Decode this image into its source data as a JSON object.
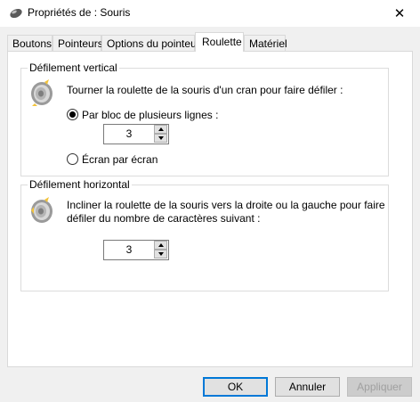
{
  "window": {
    "title": "Propriétés de : Souris",
    "close_glyph": "✕"
  },
  "tabs": [
    {
      "label": "Boutons"
    },
    {
      "label": "Pointeurs"
    },
    {
      "label": "Options du pointeur"
    },
    {
      "label": "Roulette",
      "active": true
    },
    {
      "label": "Matériel"
    }
  ],
  "vertical": {
    "title": "Défilement vertical",
    "description": "Tourner la roulette de la souris d'un cran pour faire défiler :",
    "option_lines": "Par bloc de plusieurs lignes :",
    "option_lines_checked": true,
    "lines_value": "3",
    "option_screen": "Écran par écran",
    "icon": "mouse-wheel-icon"
  },
  "horizontal": {
    "title": "Défilement horizontal",
    "description_line1": "Incliner la roulette de la souris vers la droite ou la gauche pour faire",
    "description_line2": "défiler du nombre de caractères suivant :",
    "chars_value": "3",
    "icon": "mouse-wheel-tilt-icon"
  },
  "buttons": {
    "ok": "OK",
    "cancel": "Annuler",
    "apply": "Appliquer"
  },
  "colors": {
    "accent": "#0078d7",
    "wheel_gray": "#9a9a9a",
    "wheel_yellow": "#f2c33c"
  }
}
